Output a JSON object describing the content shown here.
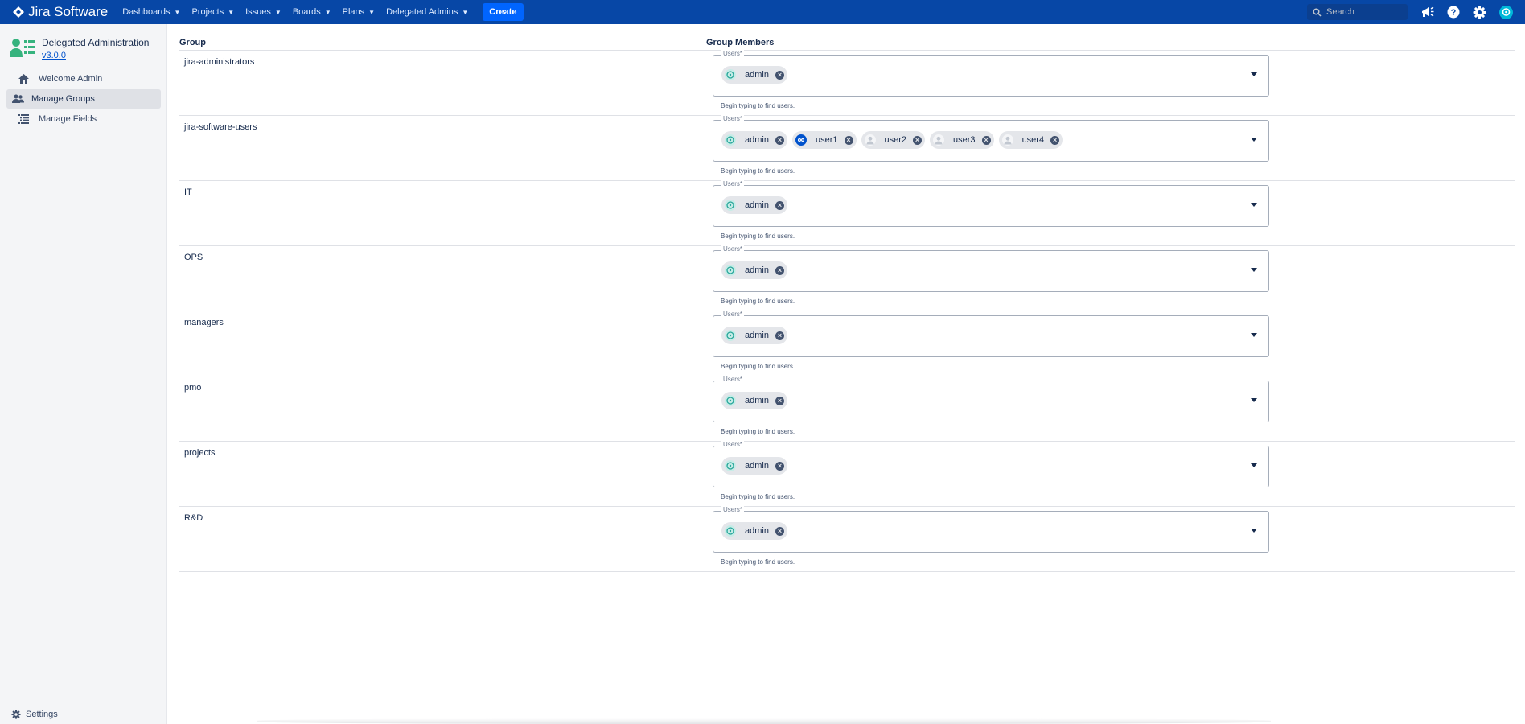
{
  "app": {
    "logo_text": "Jira Software",
    "nav": [
      {
        "label": "Dashboards"
      },
      {
        "label": "Projects"
      },
      {
        "label": "Issues"
      },
      {
        "label": "Boards"
      },
      {
        "label": "Plans"
      },
      {
        "label": "Delegated Admins"
      }
    ],
    "create_label": "Create",
    "search_placeholder": "Search",
    "icons": [
      "notifications-icon",
      "help-icon",
      "settings-gear-icon",
      "user-avatar"
    ]
  },
  "sidebar": {
    "plugin_name": "Delegated Administration",
    "version": "v3.0.0",
    "items": [
      {
        "label": "Welcome Admin",
        "icon": "home-icon",
        "active": false
      },
      {
        "label": "Manage Groups",
        "icon": "groups-icon",
        "active": true
      },
      {
        "label": "Manage Fields",
        "icon": "fields-list-icon",
        "active": false
      }
    ],
    "settings_label": "Settings"
  },
  "table": {
    "col_group": "Group",
    "col_members": "Group Members",
    "field_label": "Users*",
    "hint": "Begin typing to find users.",
    "rows": [
      {
        "group": "jira-administrators",
        "users": [
          {
            "name": "admin",
            "avatar": "teal"
          }
        ]
      },
      {
        "group": "jira-software-users",
        "users": [
          {
            "name": "admin",
            "avatar": "teal"
          },
          {
            "name": "user1",
            "avatar": "blue"
          },
          {
            "name": "user2",
            "avatar": "grey"
          },
          {
            "name": "user3",
            "avatar": "grey"
          },
          {
            "name": "user4",
            "avatar": "grey"
          }
        ]
      },
      {
        "group": "IT",
        "users": [
          {
            "name": "admin",
            "avatar": "teal"
          }
        ]
      },
      {
        "group": "OPS",
        "users": [
          {
            "name": "admin",
            "avatar": "teal"
          }
        ]
      },
      {
        "group": "managers",
        "users": [
          {
            "name": "admin",
            "avatar": "teal"
          }
        ]
      },
      {
        "group": "pmo",
        "users": [
          {
            "name": "admin",
            "avatar": "teal"
          }
        ]
      },
      {
        "group": "projects",
        "users": [
          {
            "name": "admin",
            "avatar": "teal"
          }
        ]
      },
      {
        "group": "R&D",
        "users": [
          {
            "name": "admin",
            "avatar": "teal"
          }
        ]
      }
    ]
  },
  "colors": {
    "nav_bg": "#0747a6",
    "create_btn": "#0065ff",
    "sidebar_bg": "#f4f5f7",
    "active_item": "#dfe1e6",
    "chip_bg": "#e4e6ea"
  }
}
